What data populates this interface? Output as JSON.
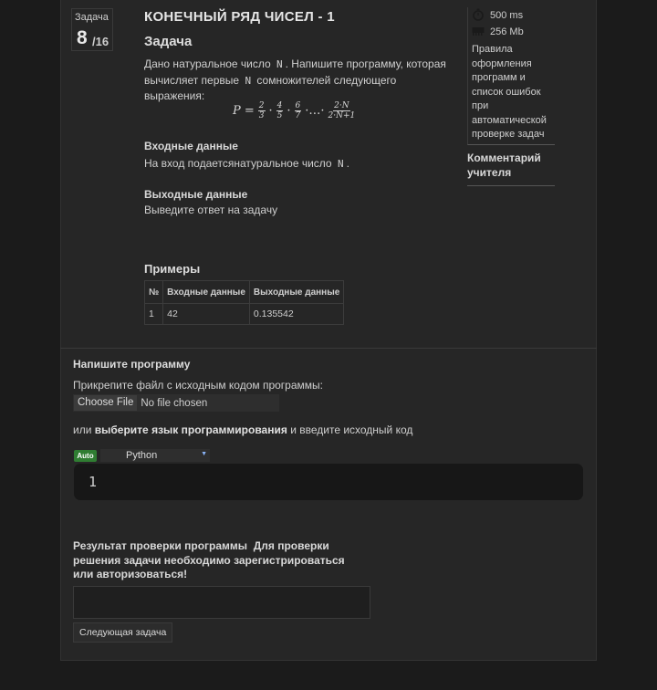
{
  "task": {
    "label": "Задача",
    "number": "8",
    "total": "/16",
    "title": "КОНЕЧНЫЙ РЯД ЧИСЕЛ - 1",
    "heading": "Задача"
  },
  "statement": {
    "p1": "Дано натуральное число",
    "var_n": "N",
    "p2": ". Напишите программу, которая вычисляет первые",
    "p3": "сомножителей следующего выражения:",
    "formula": {
      "lhs": "P =",
      "f1_num": "2",
      "f1_den": "3",
      "f2_num": "4",
      "f2_den": "5",
      "f3_num": "6",
      "f3_den": "7",
      "dots": "·…·",
      "fn_num": "2·N",
      "fn_den": "2·N+1"
    }
  },
  "input_section": {
    "heading": "Входные данные",
    "text": "На вход подается",
    "text2": "натуральное число",
    "var": "N",
    "end": "."
  },
  "output_section": {
    "heading": "Выходные данные",
    "text": "Выведите ответ на задачу"
  },
  "examples": {
    "heading": "Примеры",
    "columns": [
      "№",
      "Входные данные",
      "Выходные данные"
    ],
    "rows": [
      [
        "1",
        "42",
        "0.135542"
      ]
    ]
  },
  "sidebar": {
    "time_limit": "500 ms",
    "memory_limit": "256 Mb",
    "rules_link": "Правила оформления программ и список ошибок при автоматической проверке задач",
    "teacher_comment": "Комментарий учителя"
  },
  "submit": {
    "heading": "Напишите программу",
    "attach_text": "Прикрепите файл с исходным кодом программы:",
    "file_button": "Choose File",
    "file_status": "No file chosen",
    "or": "или",
    "choose_lang": "выберите язык программирования",
    "enter_code": "и введите исходный код",
    "auto_badge": "Auto",
    "language": "Python",
    "line_number": "1"
  },
  "result": {
    "label": "Результат проверки программы",
    "notice": "Для проверки решения задачи необходимо зарегистрироваться или авторизоваться!",
    "next_button": "Следующая задача"
  },
  "colors": {
    "background": "#1b1b1b",
    "panel": "#262626",
    "auto_badge": "#2f7d32"
  }
}
